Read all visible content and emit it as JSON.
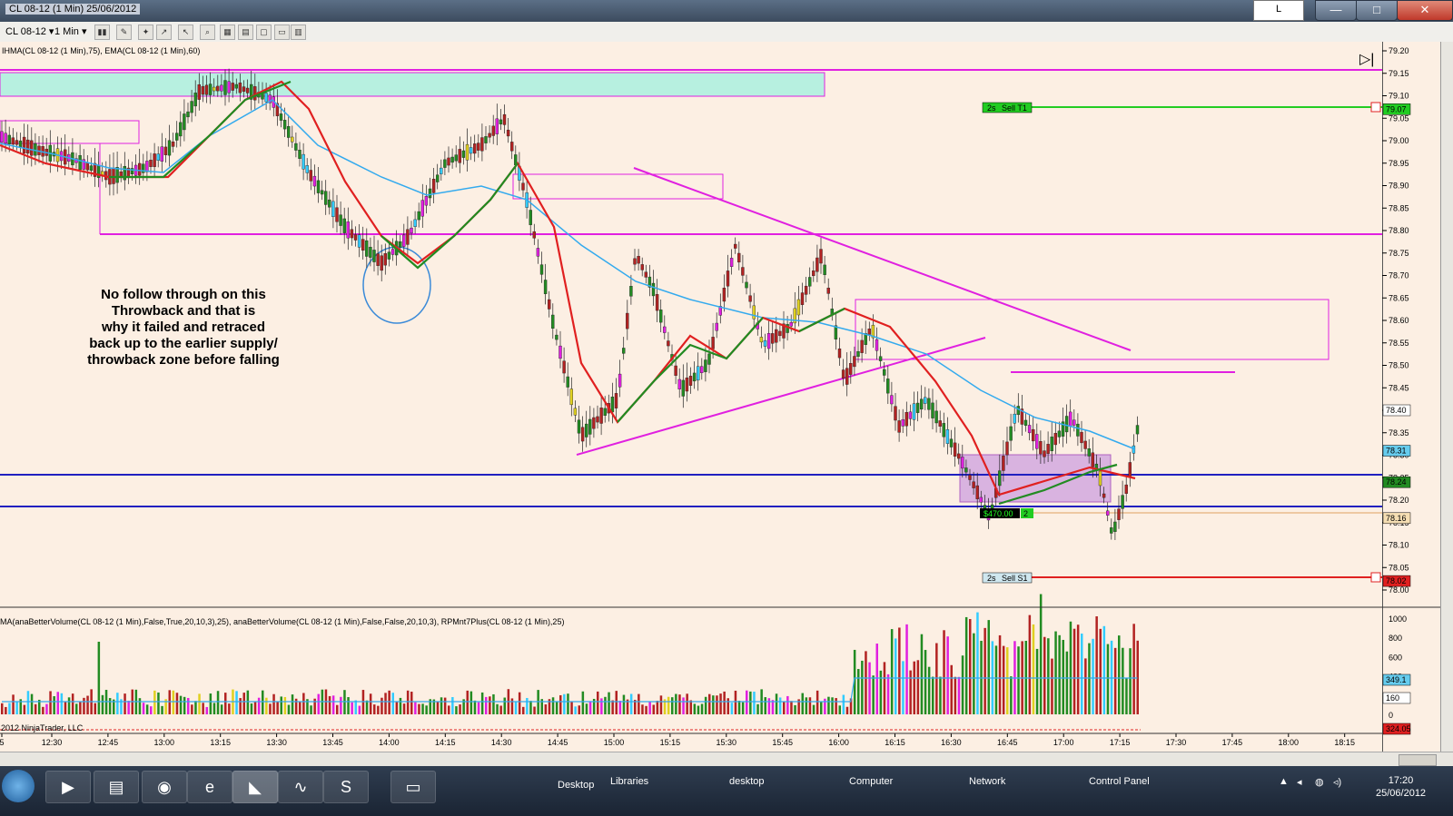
{
  "window": {
    "title": "CL 08-12 (1 Min)  25/06/2012",
    "link_button": "L",
    "minimize": "—",
    "maximize": "□",
    "close": "✕"
  },
  "toolbar": {
    "instrument": "CL 08-12",
    "interval": "1 Min",
    "icons": [
      "bar-type-icon",
      "draw-pencil-icon",
      "pin-icon",
      "pointer-icon",
      "cursor-icon",
      "zoom-icon",
      "data-box-icon",
      "properties-icon",
      "copy-icon",
      "panels-icon"
    ]
  },
  "price_panel": {
    "indicator_label": "IHMA(CL 08-12 (1 Min),75), EMA(CL 08-12 (1 Min),60)",
    "y_ticks": [
      "79.20",
      "79.15",
      "79.10",
      "79.05",
      "79.00",
      "78.95",
      "78.90",
      "78.85",
      "78.80",
      "78.75",
      "78.70",
      "78.65",
      "78.60",
      "78.55",
      "78.50",
      "78.45",
      "78.40",
      "78.35",
      "78.30",
      "78.25",
      "78.20",
      "78.15",
      "78.10",
      "78.05",
      "78.00"
    ],
    "price_markers": [
      {
        "text": "79.07",
        "color": "#22cc22"
      },
      {
        "text": "78.40",
        "color": "#ffffff"
      },
      {
        "text": "78.31",
        "color": "#66ccee"
      },
      {
        "text": "78.24",
        "color": "#228b22"
      },
      {
        "text": "78.16",
        "color": "#f5deb3"
      },
      {
        "text": "78.02",
        "color": "#e02020"
      }
    ],
    "orders": [
      {
        "qty": "2s",
        "label": "Sell T1",
        "color": "#22cc22"
      },
      {
        "qty": "2s",
        "label": "Sell S1",
        "color": "#e02020"
      }
    ],
    "position": {
      "pnl": "$470.00",
      "qty": "2"
    },
    "annotation": [
      "No follow through on this",
      "Throwback and that is",
      "why it failed and retraced",
      "back up to the earlier supply/",
      "throwback zone before falling"
    ],
    "play_icon": "▷|"
  },
  "volume_panel": {
    "indicator_label": "MA(anaBetterVolume(CL 08-12 (1 Min),False,True,20,10,3),25), anaBetterVolume(CL 08-12 (1 Min),False,False,20,10,3), RPMnt7Plus(CL 08-12 (1 Min),25)",
    "y_ticks": [
      "1000",
      "800",
      "600",
      "400",
      "200",
      "0"
    ],
    "markers": [
      {
        "text": "349.1",
        "color": "#66ccee"
      },
      {
        "text": "160",
        "color": "#ffffff"
      },
      {
        "text": "324.05",
        "color": "#e02020"
      }
    ]
  },
  "copyright": "2012 NinjaTrader, LLC",
  "x_axis": {
    "ticks": [
      "5",
      "12:30",
      "12:45",
      "13:00",
      "13:15",
      "13:30",
      "13:45",
      "14:00",
      "14:15",
      "14:30",
      "14:45",
      "15:00",
      "15:15",
      "15:30",
      "15:45",
      "16:00",
      "16:15",
      "16:30",
      "16:45",
      "17:00",
      "17:15",
      "17:30",
      "17:45",
      "18:00",
      "18:15"
    ]
  },
  "taskbar": {
    "desktop": "Desktop",
    "libraries": "Libraries",
    "desktop_folder": "desktop",
    "computer": "Computer",
    "network": "Network",
    "control_panel": "Control Panel",
    "time": "17:20",
    "date": "25/06/2012"
  }
}
